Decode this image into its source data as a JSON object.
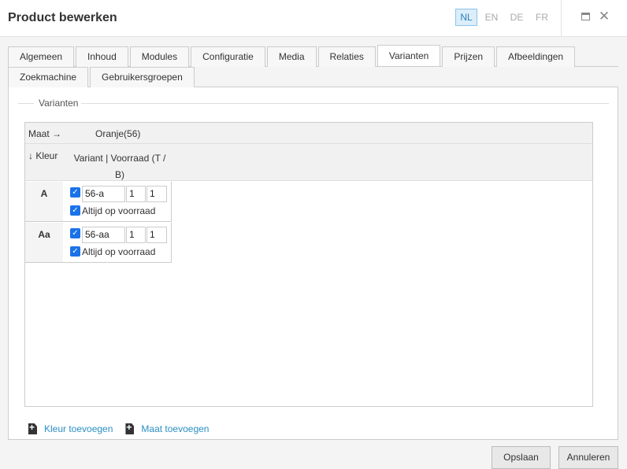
{
  "header": {
    "title": "Product bewerken",
    "languages": [
      {
        "label": "NL",
        "active": true
      },
      {
        "label": "EN",
        "active": false
      },
      {
        "label": "DE",
        "active": false
      },
      {
        "label": "FR",
        "active": false
      }
    ],
    "close_symbol": "✕"
  },
  "tabs": {
    "row1": [
      "Algemeen",
      "Inhoud",
      "Modules",
      "Configuratie",
      "Media",
      "Relaties",
      "Varianten",
      "Prijzen",
      "Afbeeldingen"
    ],
    "row2": [
      "Zoekmachine",
      "Gebruikersgroepen"
    ],
    "active": "Varianten"
  },
  "section": {
    "legend": "Varianten"
  },
  "grid": {
    "size_header": "Maat →",
    "size_value": "Oranje(56)",
    "color_header": "↓ Kleur",
    "variant_header": "Variant | Voorraad (T / B)",
    "rows": [
      {
        "color": "A",
        "variant": "56-a",
        "stock_t": "1",
        "stock_b": "1",
        "checked": true,
        "always_label": "Altijd op voorraad",
        "always_checked": true
      },
      {
        "color": "Aa",
        "variant": "56-aa",
        "stock_t": "1",
        "stock_b": "1",
        "checked": true,
        "always_label": "Altijd op voorraad",
        "always_checked": true
      }
    ]
  },
  "actions": {
    "add_color": "Kleur toevoegen",
    "add_size": "Maat toevoegen"
  },
  "footer": {
    "save": "Opslaan",
    "cancel": "Annuleren"
  },
  "colors": {
    "accent": "#2a8fc6",
    "checkbox": "#1a73e8",
    "active_lang_bg": "#dbeef9"
  }
}
